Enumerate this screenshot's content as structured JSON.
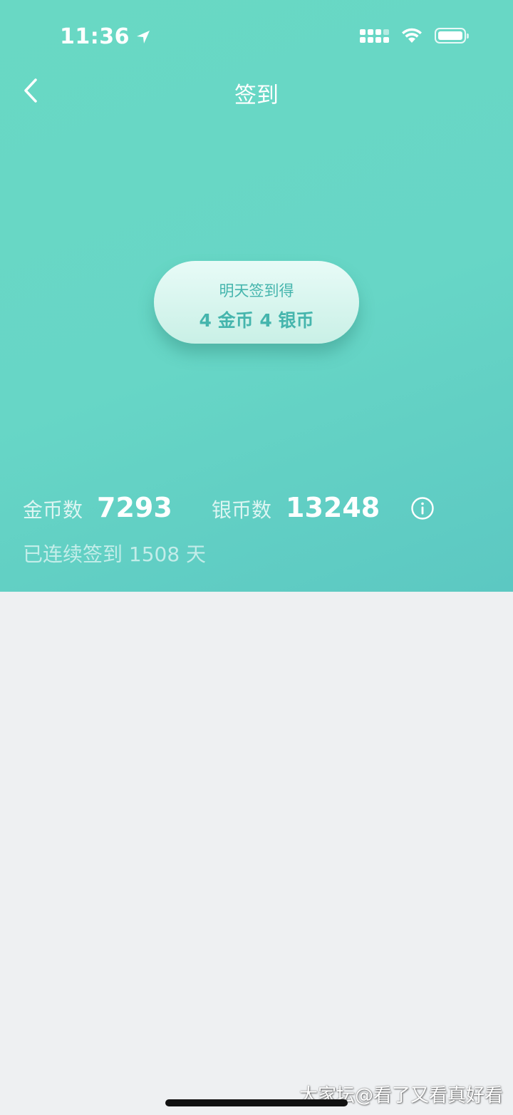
{
  "status_bar": {
    "time": "11:36"
  },
  "nav": {
    "title": "签到"
  },
  "checkin": {
    "line1": "明天签到得",
    "line2": "4 金币 4 银币"
  },
  "stats": {
    "gold_label": "金币数",
    "gold_value": "7293",
    "silver_label": "银币数",
    "silver_value": "13248"
  },
  "streak": "已连续签到 1508 天",
  "watermark": "大家坛@看了又看真好看",
  "colors": {
    "header_top": "#69d8c4",
    "header_bottom": "#5cc8c2",
    "pill_text": "#45b5ad",
    "body_bg": "#eef0f2"
  }
}
